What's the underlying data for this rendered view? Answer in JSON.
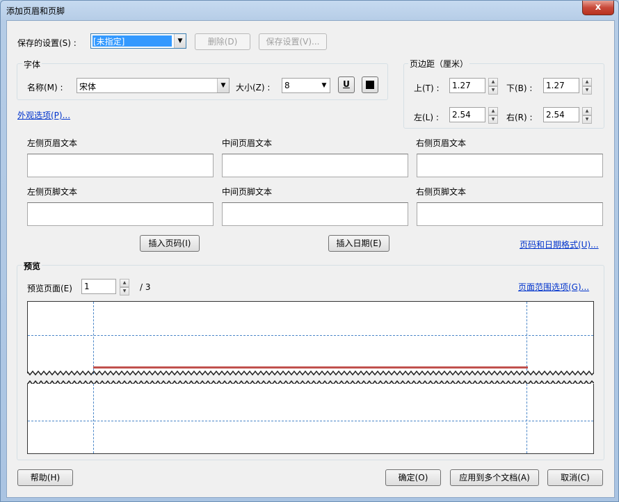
{
  "window": {
    "title": "添加页眉和页脚",
    "close_glyph": "x"
  },
  "saved_settings": {
    "label": "保存的设置(S) :",
    "value": "[未指定]",
    "delete_label": "删除(D)",
    "save_label": "保存设置(V)..."
  },
  "font": {
    "group_label": "字体",
    "name_label": "名称(M) :",
    "name_value": "宋体",
    "size_label": "大小(Z) :",
    "size_value": "8",
    "underline_glyph": "U"
  },
  "margins": {
    "group_label": "页边距（厘米）",
    "top_label": "上(T) :",
    "top_value": "1.27",
    "bottom_label": "下(B) :",
    "bottom_value": "1.27",
    "left_label": "左(L) :",
    "left_value": "2.54",
    "right_label": "右(R) :",
    "right_value": "2.54"
  },
  "appearance_link": "外观选项(P)...",
  "fields": {
    "left_header": "左侧页眉文本",
    "center_header": "中间页眉文本",
    "right_header": "右侧页眉文本",
    "left_footer": "左侧页脚文本",
    "center_footer": "中间页脚文本",
    "right_footer": "右侧页脚文本"
  },
  "insert_page_label": "插入页码(I)",
  "insert_date_label": "插入日期(E)",
  "page_date_format_link": "页码和日期格式(U)...",
  "preview": {
    "group_label": "预览",
    "page_label": "预览页面(E)",
    "page_value": "1",
    "total": "/ 3",
    "range_link": "页面范围选项(G)..."
  },
  "buttons": {
    "help": "帮助(H)",
    "ok": "确定(O)",
    "apply_multi": "应用到多个文档(A)",
    "cancel": "取消(C)"
  },
  "colors": {
    "selection": "#3399ff",
    "link": "#0033cc",
    "header_line": "#c0504d",
    "guide": "#4a86c8"
  }
}
